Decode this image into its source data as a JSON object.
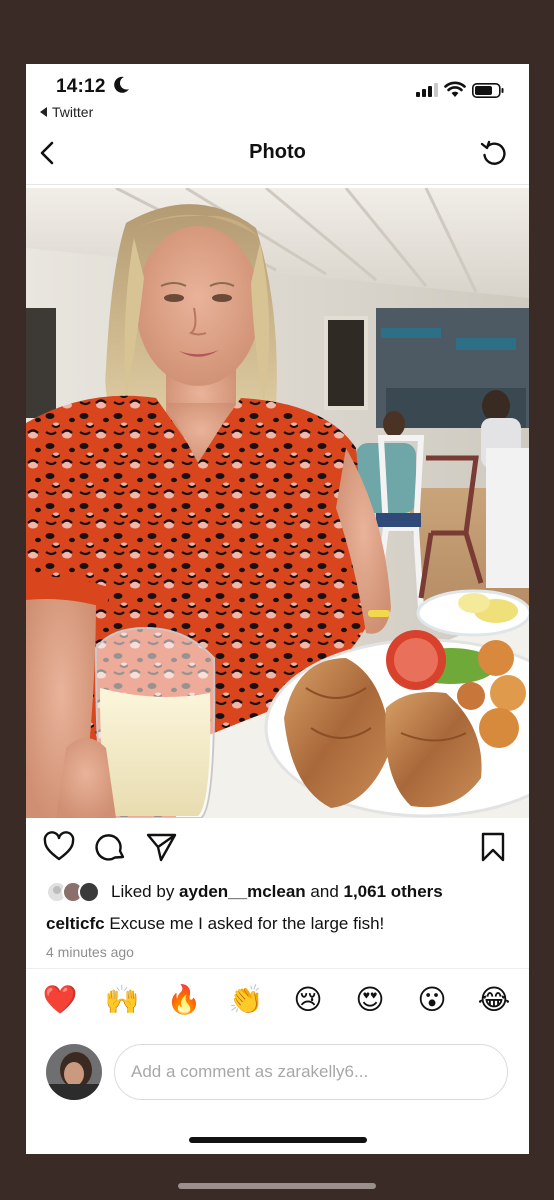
{
  "status_bar": {
    "time": "14:12",
    "back_app": "Twitter",
    "icons": [
      "moon-icon",
      "signal-icon",
      "wifi-icon",
      "battery-icon"
    ]
  },
  "nav": {
    "title": "Photo",
    "icons": [
      "chevron-left-icon",
      "refresh-icon"
    ]
  },
  "post": {
    "actions": [
      "heart-icon",
      "comment-icon",
      "share-icon",
      "bookmark-icon"
    ],
    "likes_prefix": "Liked by ",
    "liked_by_user": "ayden__mclean",
    "likes_and": " and ",
    "likes_others": "1,061 others",
    "caption_user": "celticfc",
    "caption_text": " Excuse me I asked for the large fish!",
    "time_ago": "4 minutes ago"
  },
  "quick_reactions": [
    "❤️",
    "🙌",
    "🔥",
    "👏",
    "😢",
    "😍",
    "😮",
    "😂"
  ],
  "comment": {
    "placeholder": "Add a comment as zarakelly6..."
  },
  "colors": {
    "frame": "#3b2b26",
    "dress": "#d9461e",
    "text_secondary": "#8e8e8e",
    "border": "#dbdbdb"
  }
}
